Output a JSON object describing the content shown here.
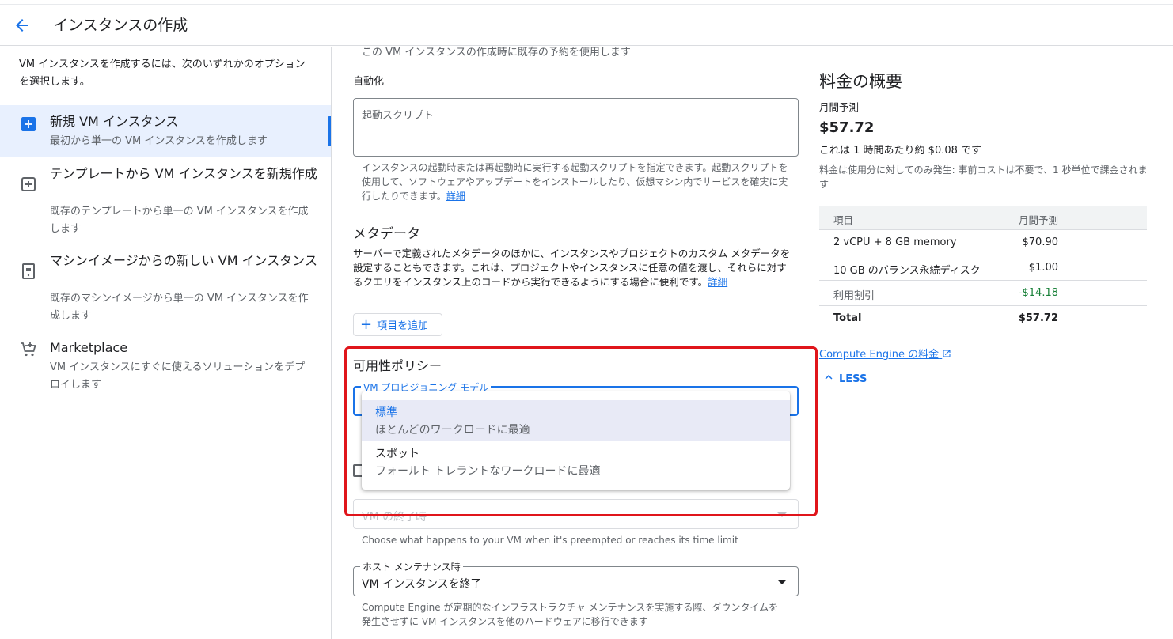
{
  "header": {
    "title": "インスタンスの作成",
    "back_icon": "arrow-back-icon"
  },
  "left": {
    "intro": "VM インスタンスを作成するには、次のいずれかのオプションを選択します。",
    "options": [
      {
        "title": "新規 VM インスタンス",
        "desc": "最初から単一の VM インスタンスを作成します",
        "icon": "add-box-icon",
        "selected": true
      },
      {
        "title": "テンプレートから VM インスタンスを新規作成",
        "desc": "既存のテンプレートから単一の VM インスタンスを作成します",
        "icon": "add-box-outline-icon"
      },
      {
        "title": "マシンイメージからの新しい VM インスタンス",
        "desc": "既存のマシンイメージから単一の VM インスタンスを作成します",
        "icon": "machine-image-icon"
      },
      {
        "title": "Marketplace",
        "desc": "VM インスタンスにすぐに使えるソリューションをデプロイします",
        "icon": "cart-add-icon"
      }
    ]
  },
  "main": {
    "cut_text": "この VM インスタンスの作成時に既存の予約を使用します",
    "automation_label": "自動化",
    "startup_script_placeholder": "起動スクリプト",
    "automation_help": "インスタンスの起動時または再起動時に実行する起動スクリプトを指定できます。起動スクリプトを使用して、ソフトウェアやアップデートをインストールしたり、仮想マシン内でサービスを確実に実行したりできます。",
    "details_link": "詳細",
    "metadata_heading": "メタデータ",
    "metadata_text": "サーバーで定義されたメタデータのほかに、インスタンスやプロジェクトのカスタム メタデータを設定することもできます。これは、プロジェクトやインスタンスに任意の値を渡し、それらに対するクエリをインスタンス上のコードから実行できるようにする場合に便利です。",
    "add_item": "項目を追加",
    "availability_heading": "可用性ポリシー",
    "provisioning_label": "VM プロビジョニング モデル",
    "provisioning_options": [
      {
        "title": "標準",
        "desc": "ほとんどのワークロードに最適",
        "active": true
      },
      {
        "title": "スポット",
        "desc": "フォールト トレラントなワークロードに最適"
      }
    ],
    "termination_placeholder": "VM の終了時",
    "termination_help": "Choose what happens to your VM when it's preempted or reaches its time limit",
    "host_maintenance_label": "ホスト メンテナンス時",
    "host_maintenance_value": "VM インスタンスを終了",
    "host_maintenance_help": "Compute Engine が定期的なインフラストラクチャ メンテナンスを実施する際、ダウンタイムを発生させずに VM インスタンスを他のハードウェアに移行できます"
  },
  "pricing": {
    "title": "料金の概要",
    "monthly_label": "月間予測",
    "price": "$57.72",
    "hourly": "これは 1 時間あたり約 $0.08 です",
    "note": "料金は使用分に対してのみ発生: 事前コストは不要で、1 秒単位で課金されます",
    "table_headers": [
      "項目",
      "月間予測"
    ],
    "rows": [
      {
        "item": "2 vCPU + 8 GB memory",
        "cost": "$70.90"
      },
      {
        "item": "10 GB のバランス永続ディスク",
        "cost": "$1.00"
      },
      {
        "item": "利用割引",
        "cost": "-$14.18"
      },
      {
        "item": "Total",
        "cost": "$57.72"
      }
    ],
    "link": "Compute Engine の料金",
    "less": "LESS"
  },
  "colors": {
    "accent": "#1a73e8",
    "highlight": "#e0151b",
    "discount": "#188038",
    "selected_bg": "#e8f0fe"
  }
}
